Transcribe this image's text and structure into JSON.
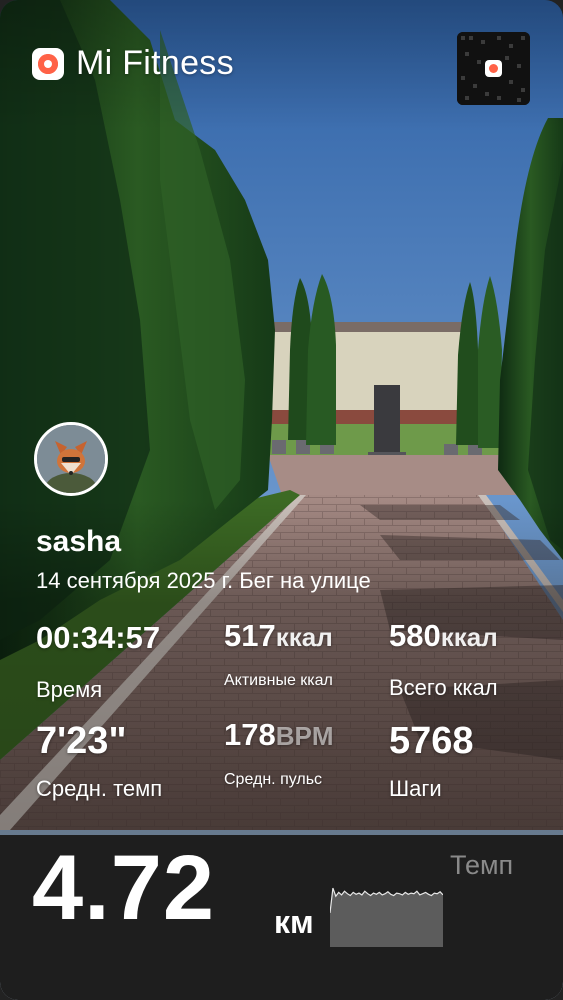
{
  "app": {
    "name": "Mi Fitness",
    "brand_color": "#ff6247"
  },
  "qr_code": {
    "icon": "qr-code-icon"
  },
  "profile": {
    "username": "sasha",
    "avatar": "fox-character-avatar"
  },
  "workout": {
    "date_and_type": "14 сентября 2025 г. Бег на улице"
  },
  "stats": {
    "time": {
      "value": "00:34:57",
      "label": "Время"
    },
    "active_kcal": {
      "value": "517",
      "unit": "ккал",
      "label": "Активные ккал"
    },
    "total_kcal": {
      "value": "580",
      "unit": "ккал",
      "label": "Всего ккал"
    },
    "avg_pace": {
      "value": "7'23\"",
      "label": "Средн. темп"
    },
    "avg_heart_rate": {
      "value": "178",
      "unit": "BPM",
      "label": "Средн. пульс"
    },
    "steps": {
      "value": "5768",
      "label": "Шаги"
    }
  },
  "distance": {
    "value": "4.72",
    "unit": "км"
  },
  "pace_chart": {
    "label": "Темп",
    "values": [
      0.55,
      0.95,
      0.82,
      0.88,
      0.84,
      0.9,
      0.86,
      0.83,
      0.88,
      0.85,
      0.87,
      0.84,
      0.9,
      0.86,
      0.83,
      0.87,
      0.85,
      0.88,
      0.84,
      0.86,
      0.89,
      0.85,
      0.83,
      0.87,
      0.86,
      0.84,
      0.88,
      0.85,
      0.87,
      0.86,
      0.9,
      0.84,
      0.86,
      0.88,
      0.85,
      0.83,
      0.87,
      0.86,
      0.89,
      0.84
    ],
    "fill_color": "#5c5c5c"
  }
}
